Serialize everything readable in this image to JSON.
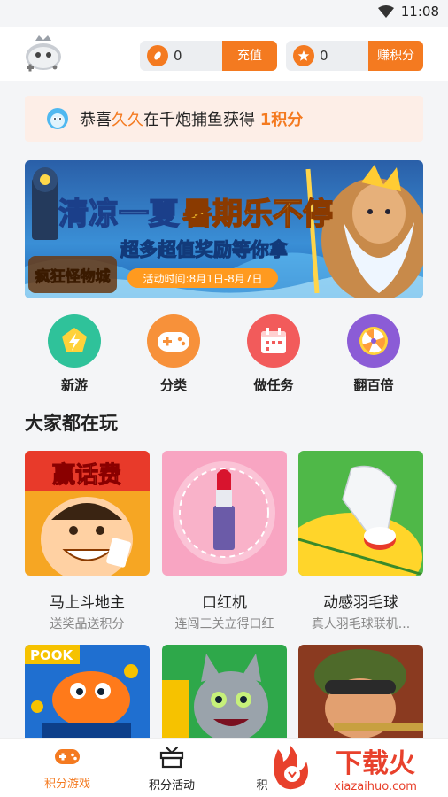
{
  "status": {
    "time": "11:08",
    "icons": [
      "wifi-icon",
      "battery-icon"
    ]
  },
  "header": {
    "logo_icon": "gamepad-mascot-logo",
    "coins": {
      "value": "0",
      "action": "充值",
      "icon": "coin-icon"
    },
    "points": {
      "value": "0",
      "action": "赚积分",
      "icon": "star-icon"
    }
  },
  "notice": {
    "prefix": "恭喜",
    "user": "久久",
    "middle": "在千炮捕鱼获得",
    "reward": "1积分"
  },
  "banner": {
    "logo": "疯狂怪物城",
    "title_part1": "清凉一夏",
    "title_part2": "暑期乐不停",
    "subtitle": "超多超值奖励等你拿",
    "dates": "活动时间:8月1日-8月7日"
  },
  "categories": [
    {
      "label": "新游",
      "icon": "lightning-icon",
      "color": "#2fc29a"
    },
    {
      "label": "分类",
      "icon": "gamepad-icon",
      "color": "#f7913a"
    },
    {
      "label": "做任务",
      "icon": "calendar-icon",
      "color": "#f25b5b"
    },
    {
      "label": "翻百倍",
      "icon": "wheel-icon",
      "color": "#8b5cd6"
    }
  ],
  "section": {
    "title": "大家都在玩"
  },
  "games": [
    {
      "name": "马上斗地主",
      "desc": "送奖品送积分",
      "art_text": "赢话费"
    },
    {
      "name": "口红机",
      "desc": "连闯三关立得口红",
      "art_text": ""
    },
    {
      "name": "动感羽毛球",
      "desc": "真人羽毛球联机...",
      "art_text": ""
    },
    {
      "name": "",
      "desc": "",
      "art_text": "POOK"
    },
    {
      "name": "",
      "desc": "",
      "art_text": ""
    },
    {
      "name": "",
      "desc": "",
      "art_text": ""
    }
  ],
  "tabs": [
    {
      "label": "积分游戏",
      "icon": "gamepad-icon",
      "active": true
    },
    {
      "label": "积分活动",
      "icon": "gift-box-icon",
      "active": false
    },
    {
      "label": "积",
      "icon": "document-icon",
      "active": false
    }
  ],
  "watermark": {
    "brand": "下载火",
    "domain": "xiazaihuo.com"
  },
  "colors": {
    "accent": "#f47a20",
    "notice_bg": "#fdeee7"
  }
}
